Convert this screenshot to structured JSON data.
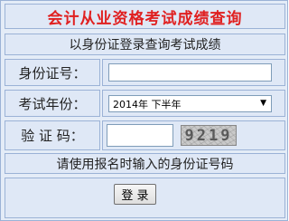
{
  "form": {
    "title": "会计从业资格考试成绩查询",
    "subtitle": "以身份证登录查询考试成绩",
    "id_label": "身份证号：",
    "id_value": "",
    "year_label": "考试年份：",
    "year_selected": "2014年 下半年",
    "code_label": "验 证 码：",
    "code_value": "",
    "captcha_text": "9219",
    "hint": "请使用报名时输入的身份证号码",
    "submit_label": "登 录"
  },
  "icons": {
    "dropdown": "chevron-down-icon"
  },
  "colors": {
    "title": "#e02020",
    "cell_bg": "#dfe8f6",
    "border": "#9bb2d6"
  }
}
